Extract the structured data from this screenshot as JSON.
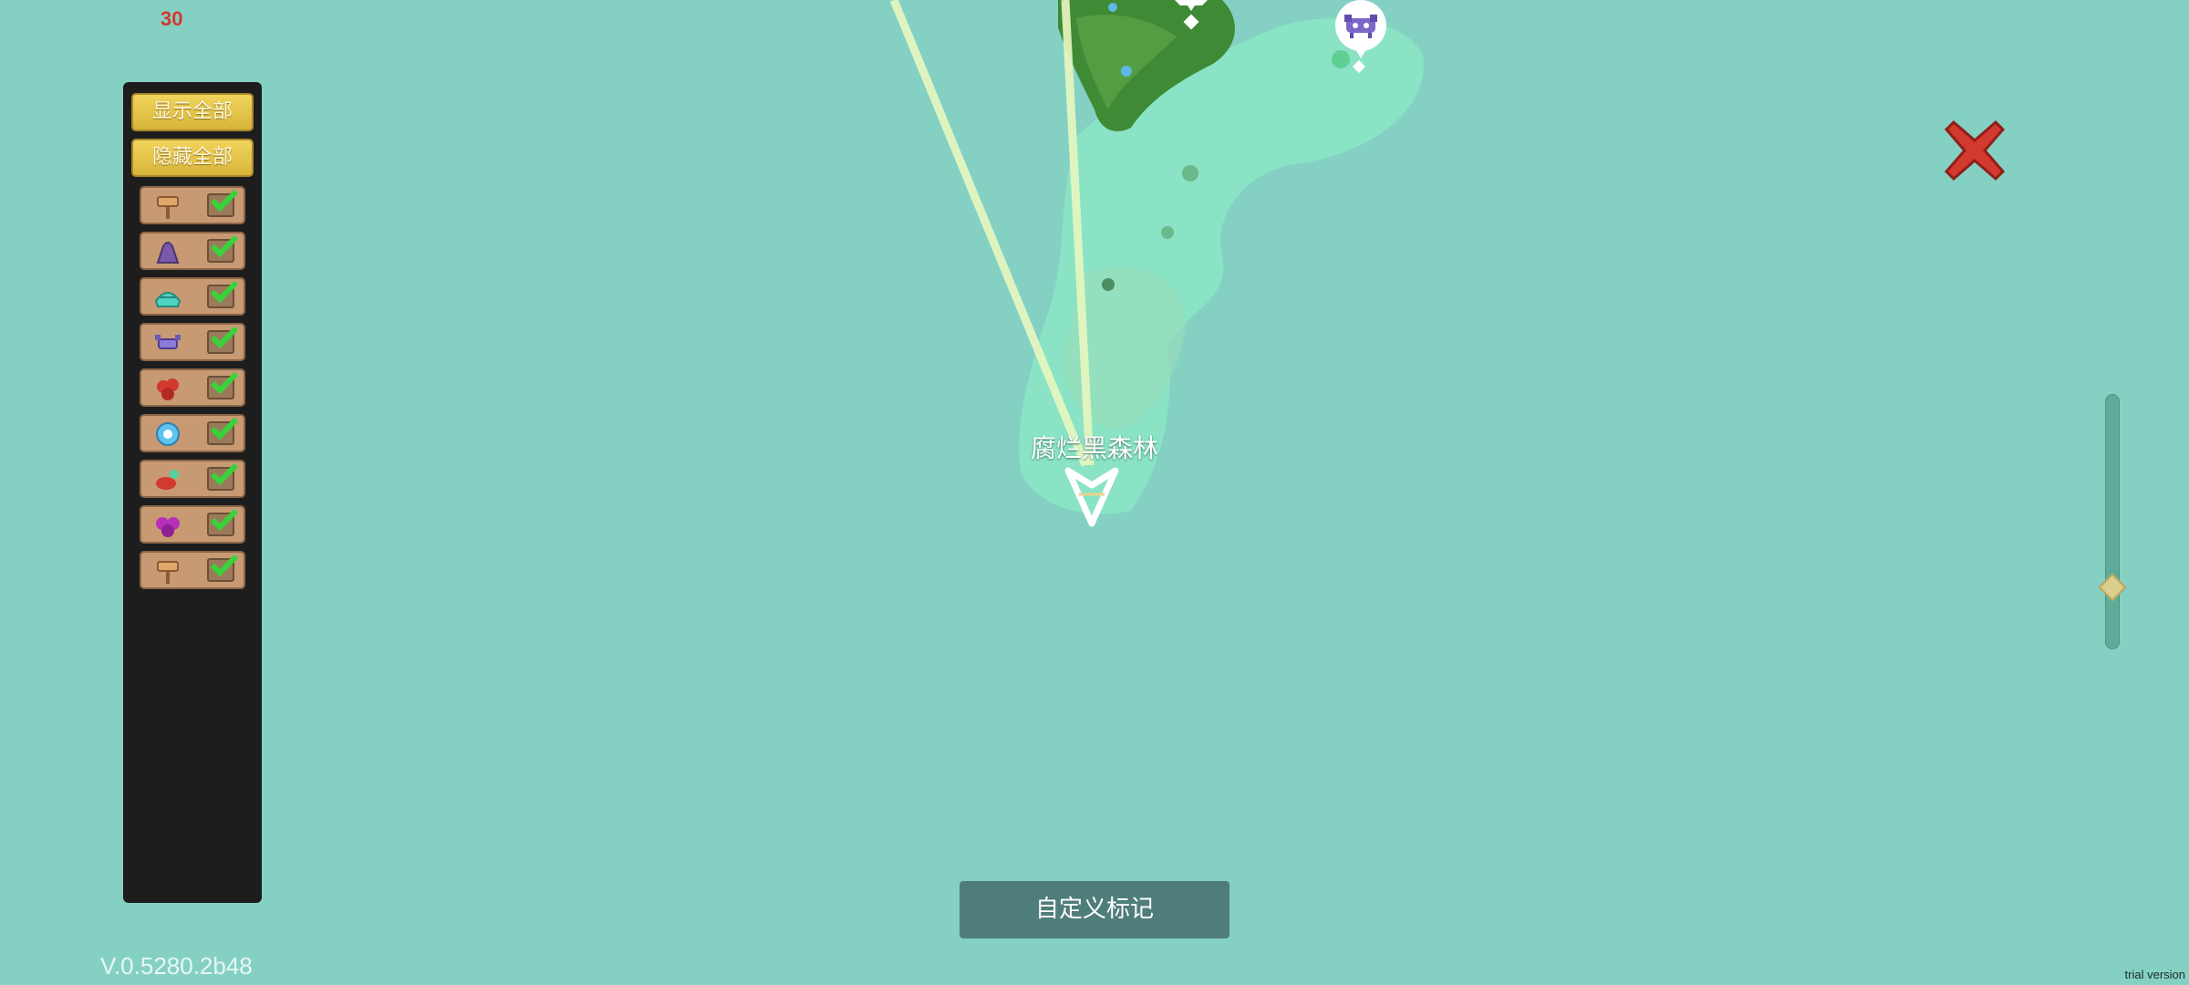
{
  "hud": {
    "fps": "30",
    "version": "V.0.5280.2b48",
    "trial_label": "trial version"
  },
  "filter_panel": {
    "show_all_label": "显示全部",
    "hide_all_label": "隐藏全部",
    "items": [
      {
        "icon": "signpost-icon",
        "checked": true
      },
      {
        "icon": "purple-rock-icon",
        "checked": true
      },
      {
        "icon": "teal-shell-icon",
        "checked": true
      },
      {
        "icon": "purple-crab-icon",
        "checked": true
      },
      {
        "icon": "red-coral-icon",
        "checked": true
      },
      {
        "icon": "blue-orb-icon",
        "checked": true
      },
      {
        "icon": "red-beast-icon",
        "checked": true
      },
      {
        "icon": "magenta-coral-icon",
        "checked": true
      },
      {
        "icon": "signpost-icon",
        "checked": true
      }
    ]
  },
  "map": {
    "location_name": "腐烂黑森林",
    "zoom_level": 0.78,
    "pois": [
      {
        "icon": "poi-pin-icon"
      },
      {
        "icon": "purple-crab-icon"
      }
    ]
  },
  "buttons": {
    "custom_mark_label": "自定义标记",
    "close": "close-icon"
  },
  "colors": {
    "ocean": "#84d1c3",
    "panel": "#1d1d1d",
    "gold": "#e9c84b",
    "close_red": "#d2392f"
  }
}
